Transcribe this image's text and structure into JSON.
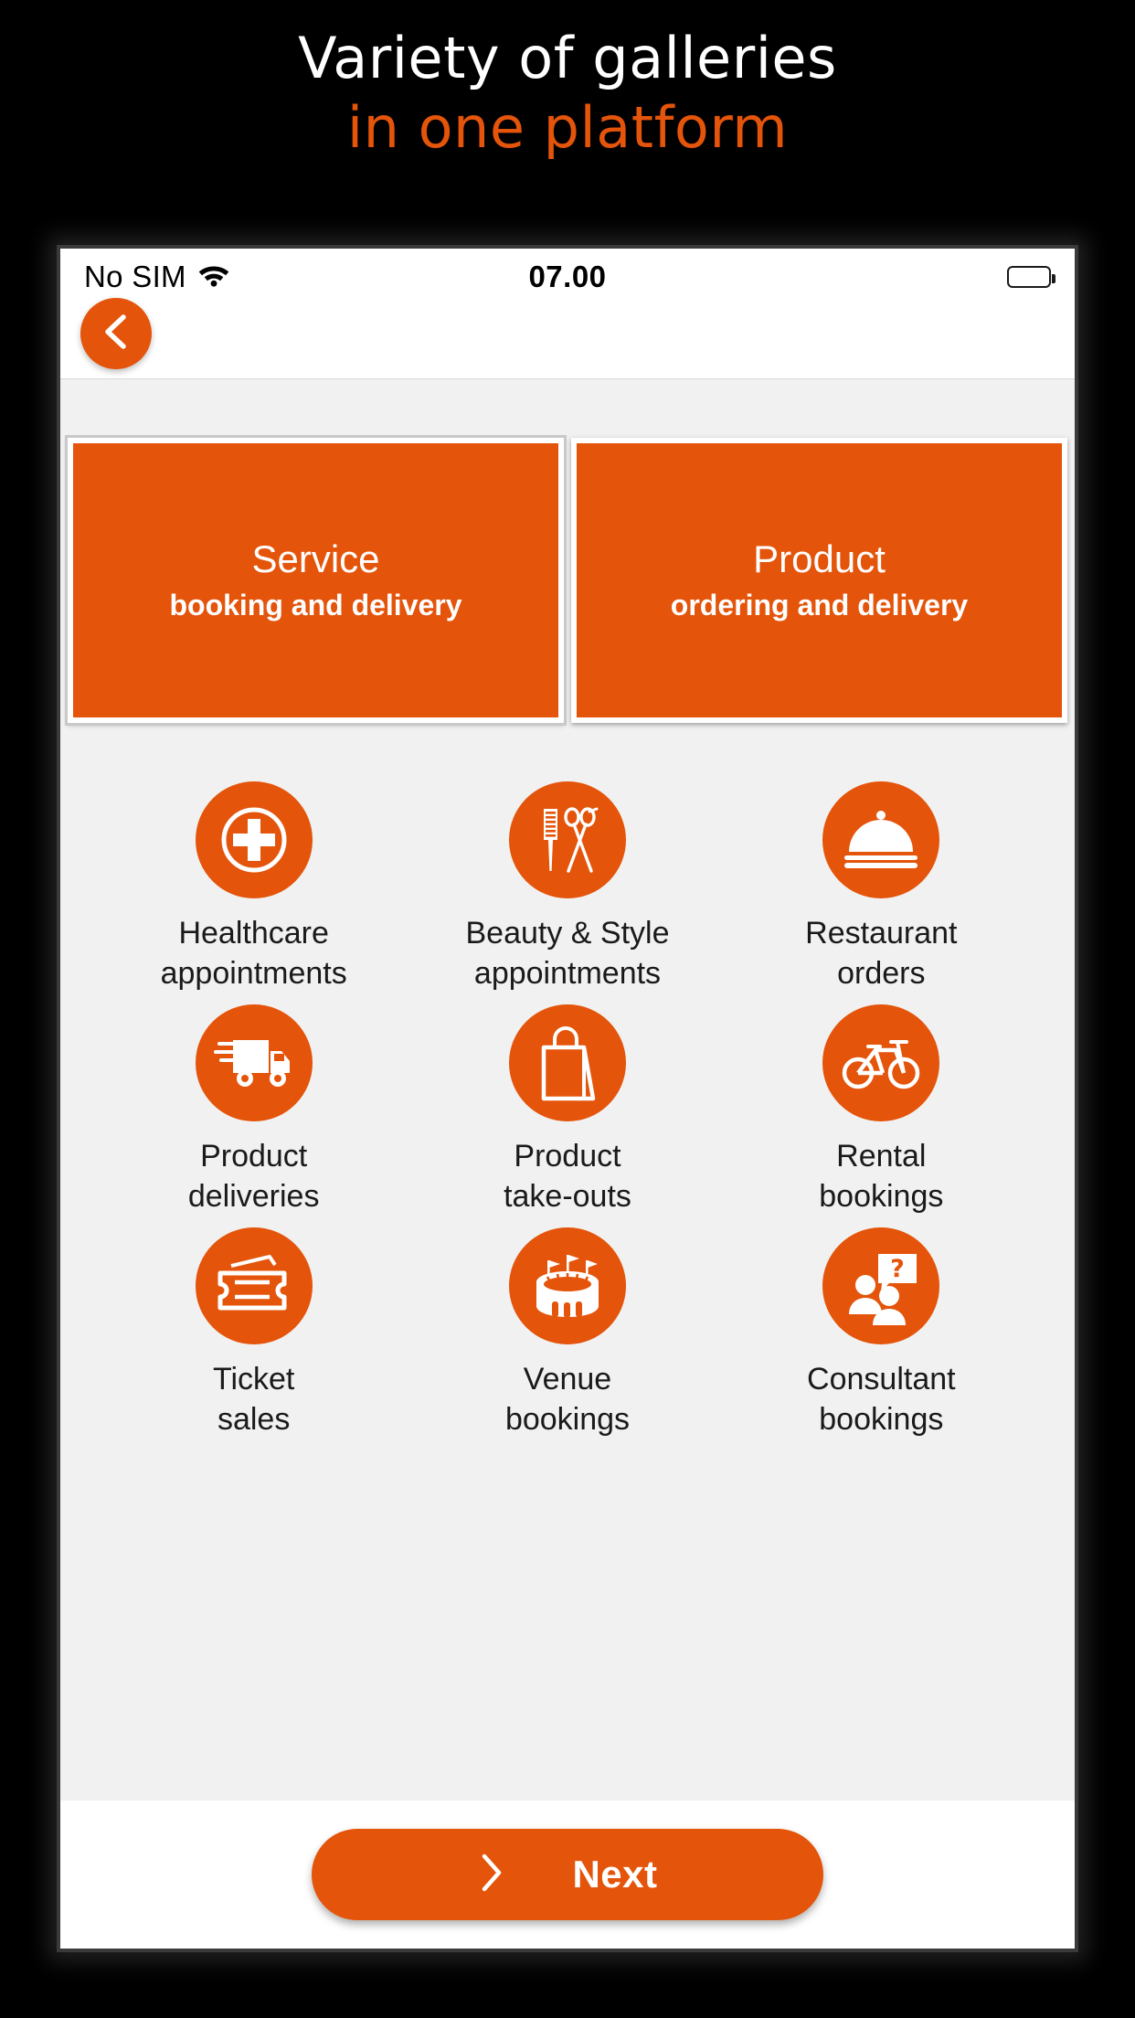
{
  "promo": {
    "line1": "Variety of galleries",
    "line2": "in one platform",
    "line1_color": "#ffffff",
    "line2_color": "#e4540a"
  },
  "theme": {
    "accent": "#e4540a",
    "screen_bg": "#f1f1f1",
    "bar_bg": "#ffffff",
    "text": "#1a1a1a"
  },
  "status_bar": {
    "carrier": "No SIM",
    "wifi_icon": "wifi-icon",
    "time": "07.00",
    "battery_icon": "battery-icon",
    "battery_level": 75
  },
  "nav": {
    "back_icon": "chevron-left-icon"
  },
  "mode_cards": [
    {
      "title": "Service",
      "subtitle": "booking and delivery",
      "selected": true
    },
    {
      "title": "Product",
      "subtitle": "ordering and delivery",
      "selected": false
    }
  ],
  "categories": [
    {
      "label": "Healthcare\nappointments",
      "icon": "medical-cross-icon"
    },
    {
      "label": "Beauty & Style\nappointments",
      "icon": "comb-scissors-icon"
    },
    {
      "label": "Restaurant\norders",
      "icon": "food-cloche-icon"
    },
    {
      "label": "Product\ndeliveries",
      "icon": "delivery-truck-icon"
    },
    {
      "label": "Product\ntake-outs",
      "icon": "shopping-bag-icon"
    },
    {
      "label": "Rental\nbookings",
      "icon": "bicycle-icon"
    },
    {
      "label": "Ticket\nsales",
      "icon": "ticket-icon"
    },
    {
      "label": "Venue\nbookings",
      "icon": "stadium-icon"
    },
    {
      "label": "Consultant\nbookings",
      "icon": "people-question-icon"
    }
  ],
  "footer": {
    "next_label": "Next",
    "next_icon": "chevron-right-icon"
  }
}
